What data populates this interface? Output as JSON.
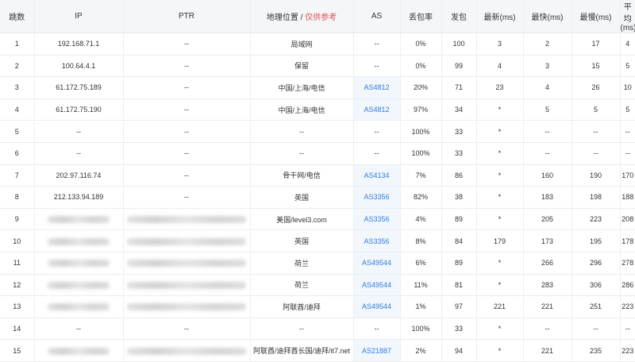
{
  "headers": {
    "hop": "跳数",
    "ip": "IP",
    "ptr": "PTR",
    "geo": "地理位置 / ",
    "geo_note": "仅供参考",
    "as": "AS",
    "loss": "丢包率",
    "sent": "发包",
    "last": "最新(ms)",
    "best": "最快(ms)",
    "worst": "最慢(ms)",
    "avg": "平均(ms)"
  },
  "rows": [
    {
      "hop": "1",
      "ip": "192.168.71.1",
      "ptr": "--",
      "geo": "局域网",
      "as": "--",
      "loss": "0%",
      "sent": "100",
      "last": "3",
      "best": "2",
      "worst": "17",
      "avg": "4"
    },
    {
      "hop": "2",
      "ip": "100.64.4.1",
      "ptr": "--",
      "geo": "保留",
      "as": "--",
      "loss": "0%",
      "sent": "99",
      "last": "4",
      "best": "3",
      "worst": "15",
      "avg": "5"
    },
    {
      "hop": "3",
      "ip": "61.172.75.189",
      "ptr": "--",
      "geo": "中国/上海/电信",
      "as": "AS4812",
      "loss": "20%",
      "sent": "71",
      "last": "23",
      "best": "4",
      "worst": "26",
      "avg": "10"
    },
    {
      "hop": "4",
      "ip": "61.172.75.190",
      "ptr": "--",
      "geo": "中国/上海/电信",
      "as": "AS4812",
      "loss": "97%",
      "sent": "34",
      "last": "*",
      "best": "5",
      "worst": "5",
      "avg": "5"
    },
    {
      "hop": "5",
      "ip": "--",
      "ptr": "--",
      "geo": "--",
      "as": "--",
      "loss": "100%",
      "sent": "33",
      "last": "*",
      "best": "--",
      "worst": "--",
      "avg": "--"
    },
    {
      "hop": "6",
      "ip": "--",
      "ptr": "--",
      "geo": "--",
      "as": "--",
      "loss": "100%",
      "sent": "33",
      "last": "*",
      "best": "--",
      "worst": "--",
      "avg": "--"
    },
    {
      "hop": "7",
      "ip": "202.97.116.74",
      "ptr": "--",
      "geo": "骨干网/电信",
      "as": "AS4134",
      "loss": "7%",
      "sent": "86",
      "last": "*",
      "best": "160",
      "worst": "190",
      "avg": "170"
    },
    {
      "hop": "8",
      "ip": "212.133.94.189",
      "ptr": "--",
      "geo": "英国",
      "as": "AS3356",
      "loss": "82%",
      "sent": "38",
      "last": "*",
      "best": "183",
      "worst": "198",
      "avg": "188"
    },
    {
      "hop": "9",
      "ip": "",
      "ptr": "",
      "geo": "美国/level3.com",
      "as": "AS3356",
      "loss": "4%",
      "sent": "89",
      "last": "*",
      "best": "205",
      "worst": "223",
      "avg": "208"
    },
    {
      "hop": "10",
      "ip": "",
      "ptr": "",
      "geo": "英国",
      "as": "AS3356",
      "loss": "8%",
      "sent": "84",
      "last": "179",
      "best": "173",
      "worst": "195",
      "avg": "178"
    },
    {
      "hop": "11",
      "ip": "",
      "ptr": "",
      "geo": "荷兰",
      "as": "AS49544",
      "loss": "6%",
      "sent": "89",
      "last": "*",
      "best": "266",
      "worst": "296",
      "avg": "278"
    },
    {
      "hop": "12",
      "ip": "",
      "ptr": "",
      "geo": "荷兰",
      "as": "AS49544",
      "loss": "11%",
      "sent": "81",
      "last": "*",
      "best": "283",
      "worst": "306",
      "avg": "286"
    },
    {
      "hop": "13",
      "ip": "",
      "ptr": "",
      "geo": "阿联酋/迪拜",
      "as": "AS49544",
      "loss": "1%",
      "sent": "97",
      "last": "221",
      "best": "221",
      "worst": "251",
      "avg": "223"
    },
    {
      "hop": "14",
      "ip": "--",
      "ptr": "--",
      "geo": "--",
      "as": "--",
      "loss": "100%",
      "sent": "33",
      "last": "*",
      "best": "--",
      "worst": "--",
      "avg": "--"
    },
    {
      "hop": "15",
      "ip": "",
      "ptr": "",
      "geo": "阿联酋/迪拜酋长国/迪拜/it7.net",
      "as": "AS21887",
      "loss": "2%",
      "sent": "94",
      "last": "*",
      "best": "221",
      "worst": "235",
      "avg": "223"
    }
  ]
}
